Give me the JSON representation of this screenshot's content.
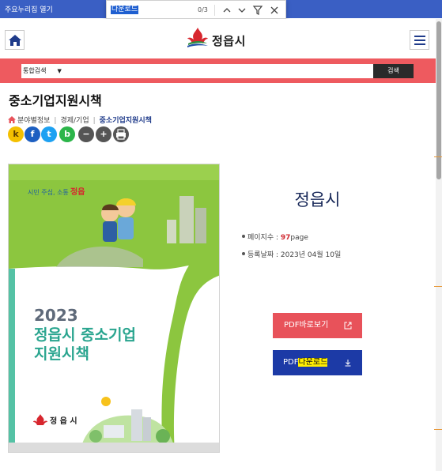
{
  "browser": {
    "skip_link": "주요누리집 열기",
    "find": {
      "query": "다운로드",
      "count": "0/3"
    }
  },
  "header": {
    "logo_text": "정읍시"
  },
  "search": {
    "category": "통합검색",
    "button": "검색"
  },
  "page": {
    "title": "중소기업지원시책",
    "breadcrumb": [
      "분야별정보",
      "경제/기업",
      "중소기업지원시책"
    ]
  },
  "share": [
    {
      "icon": "kakaostory-icon",
      "glyph": "k",
      "color": "#f4c000"
    },
    {
      "icon": "facebook-icon",
      "glyph": "f",
      "color": "#1d5fc1"
    },
    {
      "icon": "twitter-icon",
      "glyph": "t",
      "color": "#1da1f2"
    },
    {
      "icon": "band-icon",
      "glyph": "b",
      "color": "#2cb54a"
    },
    {
      "icon": "zoom-out-icon",
      "glyph": "−",
      "color": "#555555"
    },
    {
      "icon": "zoom-in-icon",
      "glyph": "+",
      "color": "#555555"
    },
    {
      "icon": "print-icon",
      "glyph": "",
      "color": "#555555"
    }
  ],
  "cover": {
    "slogan_prefix": "시민 주심, 소통",
    "slogan_city": "정읍",
    "year": "2023",
    "line1": "정읍시 중소기업",
    "line2": "지원시책",
    "footer_logo": "정 읍 시"
  },
  "document": {
    "title": "정읍시",
    "pages_label": "페이지수 : ",
    "pages_value": "97",
    "pages_unit": "page",
    "date_label": "등록날짜 : 2023년 04월 10일"
  },
  "actions": {
    "view_label": "PDF바로보기",
    "download_prefix": "PDF",
    "download_highlight": "다운로드"
  },
  "colors": {
    "accent_red": "#ee5a5f",
    "brand_blue": "#1c3aa6",
    "find_highlight": "#ffee00"
  }
}
